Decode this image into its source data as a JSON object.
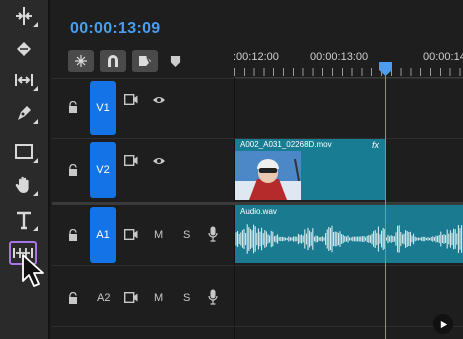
{
  "timeline": {
    "timecode": "00:00:13:09",
    "ruler_labels": [
      ":00:12:00",
      "00:00:13:00",
      "00:00:14"
    ]
  },
  "tools": [
    "ripple-edit",
    "razor",
    "slip",
    "pen",
    "rectangle",
    "hand",
    "type",
    "slide"
  ],
  "tracks": {
    "v1": {
      "label": "V1"
    },
    "v2": {
      "label": "V2"
    },
    "a1": {
      "label": "A1",
      "mute": "M",
      "solo": "S"
    },
    "a2": {
      "label": "A2",
      "mute": "M",
      "solo": "S"
    }
  },
  "clips": {
    "video": {
      "name": "A002_A031_02268D.mov",
      "fx": "fx"
    },
    "audio": {
      "name": "Audio.wav"
    }
  },
  "colors": {
    "accent": "#1473e6",
    "playhead": "#4a9df0",
    "clip": "#187c92",
    "selected_tool": "#a875e8"
  }
}
